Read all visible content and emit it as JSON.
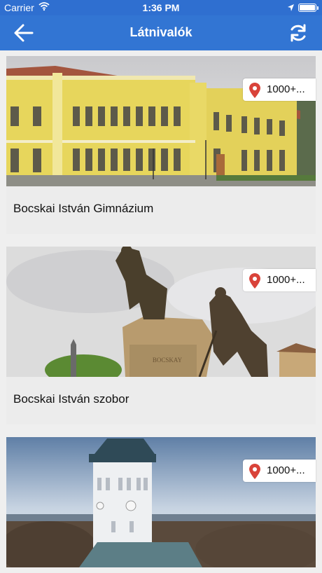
{
  "status": {
    "carrier": "Carrier",
    "time": "1:36 PM"
  },
  "nav": {
    "title": "Látnivalók",
    "back_icon": "arrow-left-icon",
    "refresh_icon": "refresh-icon"
  },
  "colors": {
    "accent": "#3275d3",
    "pin": "#d9433a"
  },
  "items": [
    {
      "name": "Bocskai István Gimnázium",
      "distance": "1000+..."
    },
    {
      "name": "Bocskai István szobor",
      "distance": "1000+..."
    },
    {
      "name": "",
      "distance": "1000+..."
    }
  ]
}
